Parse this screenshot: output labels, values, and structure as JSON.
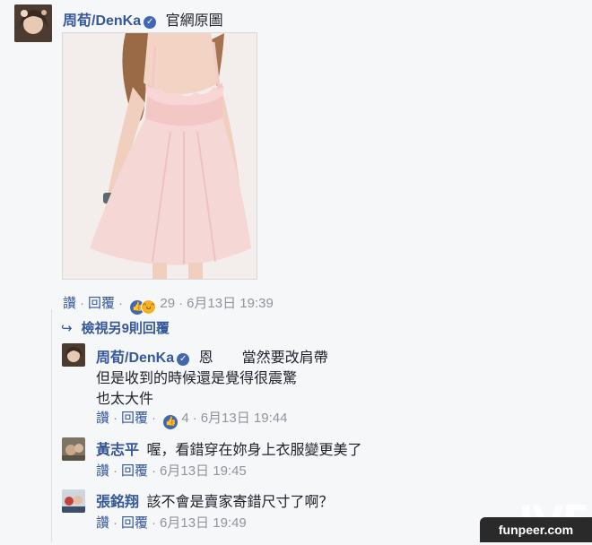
{
  "main_comment": {
    "author": "周荀/DenKa",
    "text": "官網原圖",
    "actions": {
      "like": "讚",
      "reply": "回覆"
    },
    "reaction_count": "29",
    "timestamp": "6月13日 19:39"
  },
  "view_more_replies": "檢視另9則回覆",
  "replies": [
    {
      "author": "周荀/DenKa",
      "lines": [
        "恩　　當然要改肩帶",
        "但是收到的時候還是覺得很震驚",
        "也太大件"
      ],
      "reaction_count": "4",
      "timestamp": "6月13日 19:44"
    },
    {
      "author": "黃志平",
      "lines": [
        "喔，看錯穿在妳身上衣服變更美了"
      ],
      "timestamp": "6月13日 19:45"
    },
    {
      "author": "張銘翔",
      "lines": [
        "該不會是賣家寄錯尺寸了啊？"
      ],
      "timestamp": "6月13日 19:49"
    }
  ],
  "watermark": "funpeer.com",
  "icons": [
    "verified-badge-icon",
    "like-reaction-icon",
    "haha-reaction-icon",
    "reply-arrow-icon"
  ],
  "colors": {
    "link": "#365899",
    "background": "#f6f7f9",
    "meta_gray": "#90949c"
  }
}
